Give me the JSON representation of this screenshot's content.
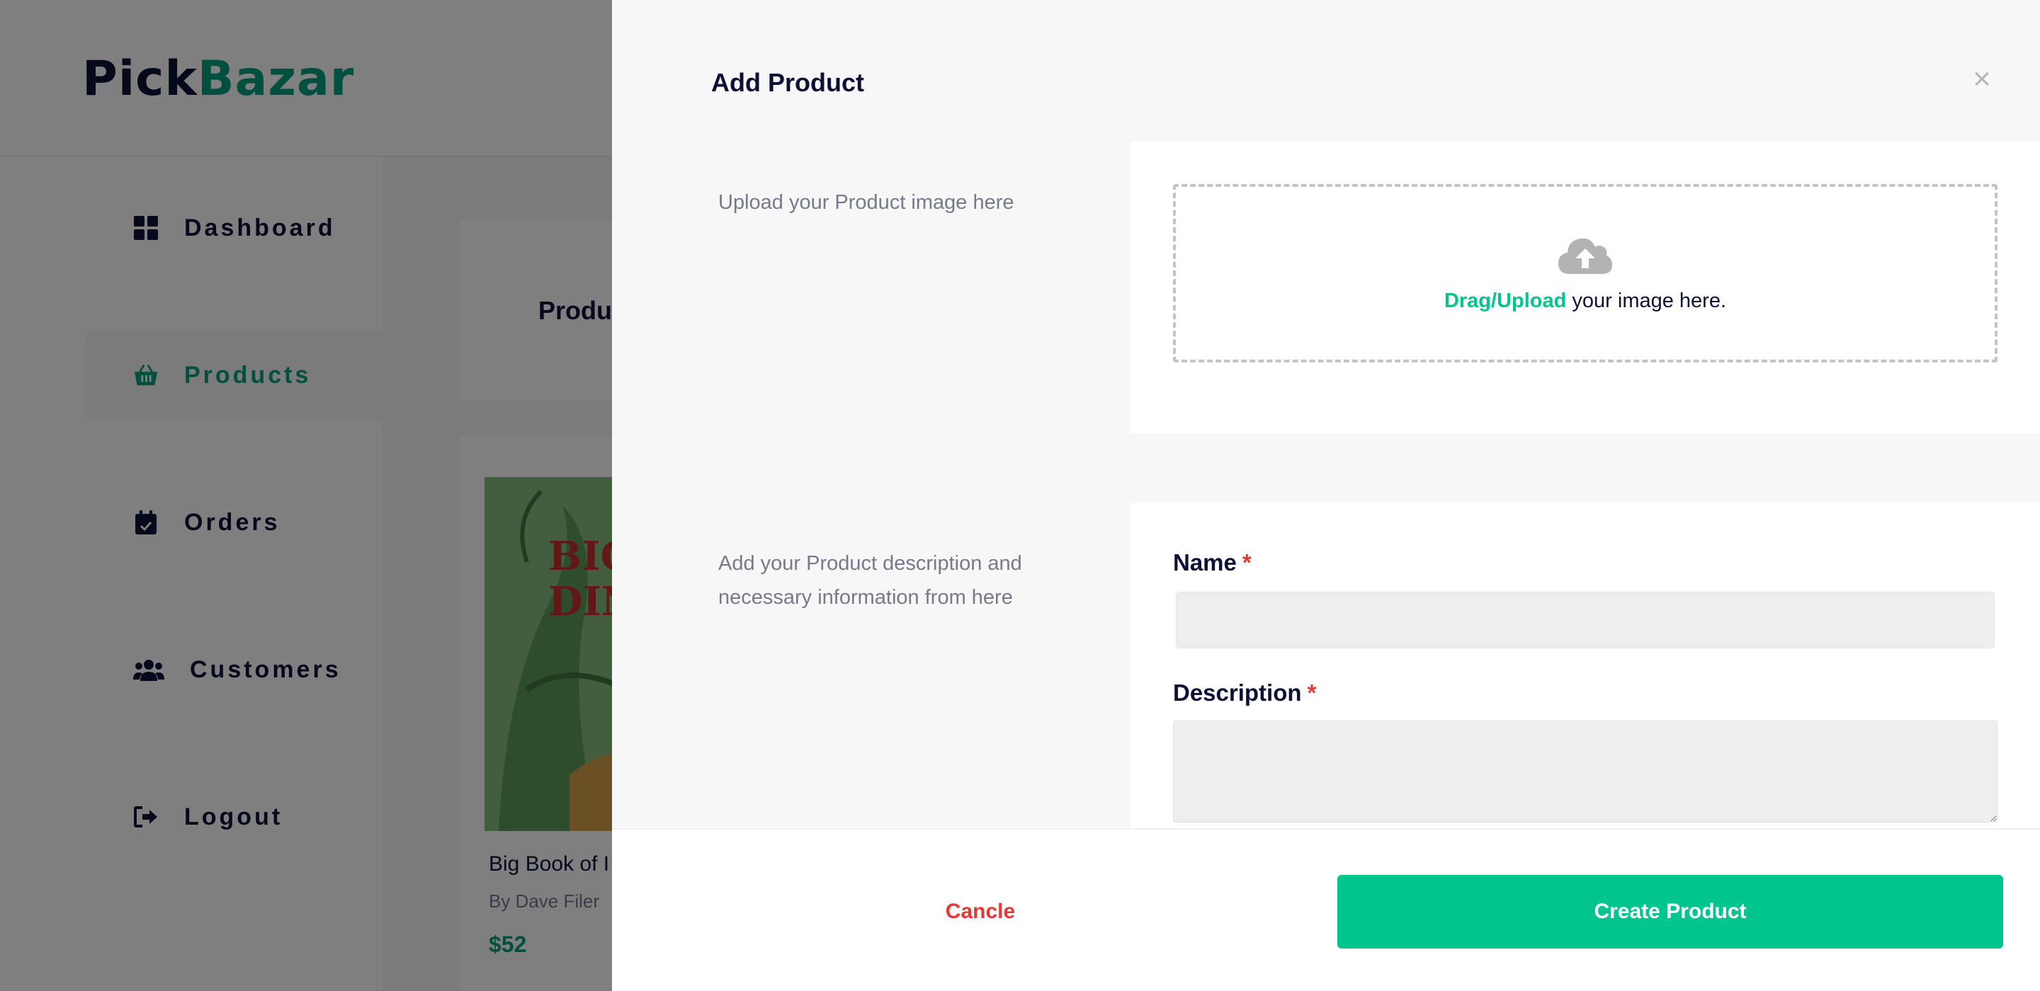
{
  "app": {
    "logo_part1": "Pick",
    "logo_part2": "Bazar"
  },
  "sidebar": {
    "items": [
      {
        "label": "Dashboard",
        "icon": "dashboard-icon",
        "active": false
      },
      {
        "label": "Products",
        "icon": "basket-icon",
        "active": true
      },
      {
        "label": "Orders",
        "icon": "calendar-check-icon",
        "active": false
      },
      {
        "label": "Customers",
        "icon": "users-icon",
        "active": false
      },
      {
        "label": "Logout",
        "icon": "logout-icon",
        "active": false
      }
    ]
  },
  "main": {
    "header_title": "Produc",
    "product_card": {
      "cover_text": "BIG B DIN",
      "name": "Big Book of I",
      "author": "By Dave Filer",
      "price": "$52"
    }
  },
  "drawer": {
    "title": "Add Product",
    "close_icon": "×",
    "upload_section": {
      "description": "Upload your Product image here",
      "drop_accent": "Drag/Upload",
      "drop_rest": " your image here."
    },
    "info_section": {
      "description": "Add your Product description and necessary information from here",
      "name_label": "Name",
      "description_label": "Description",
      "required_marker": "*"
    },
    "footer": {
      "cancel_label": "Cancle",
      "create_label": "Create Product"
    }
  },
  "colors": {
    "brand_dark": "#0d1136",
    "brand_green": "#009e7f",
    "accent": "#00c58d",
    "danger": "#e53935"
  }
}
